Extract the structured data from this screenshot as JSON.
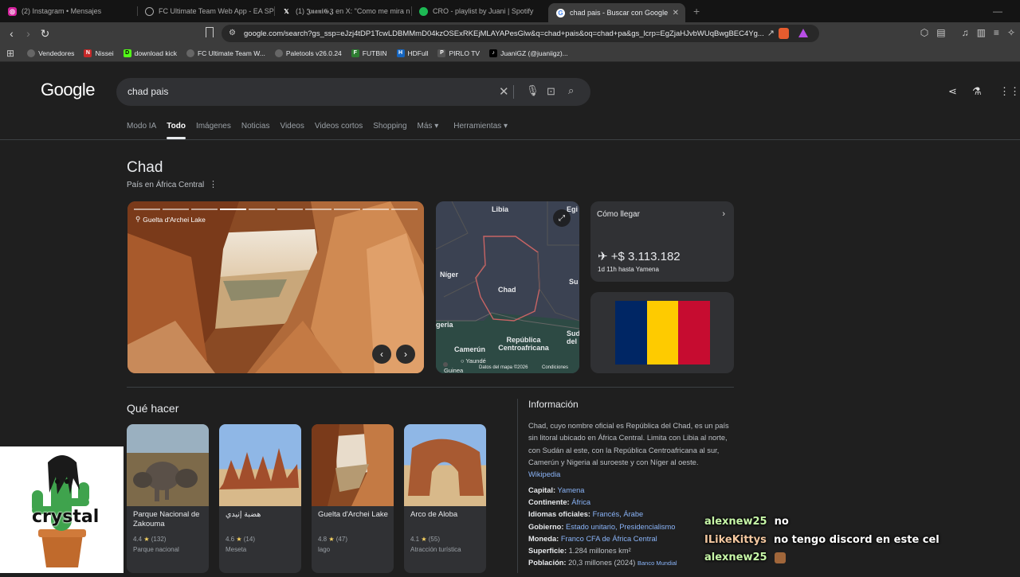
{
  "tabs": [
    {
      "label": "(2) Instagram • Mensajes",
      "icon": "instagram-icon",
      "color": "#d6249f"
    },
    {
      "label": "FC Ultimate Team Web App - EA SPO",
      "icon": "globe-icon",
      "color": "#888888"
    },
    {
      "label": "(1) 𝕵𝖚𝖆𝖓𝖎𝕲𝖅 en X: \"Como me mira n",
      "icon": "x-icon",
      "color": "#000000"
    },
    {
      "label": "CRO - playlist by Juani | Spotify",
      "icon": "spotify-icon",
      "color": "#1db954"
    },
    {
      "label": "chad pais - Buscar con Google",
      "icon": "google-icon",
      "color": "#ffffff",
      "active": true
    }
  ],
  "url": "google.com/search?gs_ssp=eJzj4tDP1TcwLDBMMmD04kzOSExRKEjMLAYAPesGlw&q=chad+pais&oq=chad+pa&gs_lcrp=EgZjaHJvbWUqBwgBEC4Yg...",
  "bookmarks": [
    {
      "label": "Vendedores",
      "icon": "globe-icon",
      "color": "#666666"
    },
    {
      "label": "Nissei",
      "icon": "nissei-icon",
      "color": "#c62828"
    },
    {
      "label": "download kick",
      "icon": "kick-icon",
      "color": "#53fc18"
    },
    {
      "label": "FC Ultimate Team W...",
      "icon": "globe-icon",
      "color": "#666666"
    },
    {
      "label": "Paletools v26.0.24",
      "icon": "globe-icon",
      "color": "#666666"
    },
    {
      "label": "FUTBIN",
      "icon": "futbin-icon",
      "color": "#2e7d32"
    },
    {
      "label": "HDFull",
      "icon": "hdfull-icon",
      "color": "#1565c0"
    },
    {
      "label": "PIRLO TV",
      "icon": "pirlo-icon",
      "color": "#555555"
    },
    {
      "label": "JuaniGZ (@juaniigz)...",
      "icon": "tiktok-icon",
      "color": "#000000"
    }
  ],
  "google": {
    "logo": "Google",
    "query": "chad pais",
    "tabs": [
      "Modo IA",
      "Todo",
      "Imágenes",
      "Noticias",
      "Videos",
      "Videos cortos",
      "Shopping",
      "Más ▾",
      "Herramientas ▾"
    ],
    "active_tab": "Todo"
  },
  "kp": {
    "title": "Chad",
    "subtitle": "País en África Central",
    "photo_label": "Guelta d'Archei Lake",
    "map_labels": {
      "libia": "Libia",
      "egipto": "Egi",
      "niger": "Níger",
      "chad": "Chad",
      "sudan": "Su",
      "nigeria": "geria",
      "camerun": "Camerún",
      "rca": "República Centroafricana",
      "yaunde": "Yaundé",
      "guinea": "Guinea",
      "sud2": "Sud del",
      "attr": "Datos del mapa ©2026",
      "cond": "Condiciones"
    },
    "route": {
      "title": "Cómo llegar",
      "price": "+$ 3.113.182",
      "duration": "1d 11h hasta Yamena"
    },
    "flag_colors": [
      "#002664",
      "#fecb00",
      "#c60c30"
    ]
  },
  "que_hacer": {
    "heading": "Qué hacer",
    "places": [
      {
        "name": "Parque Nacional de Zakouma",
        "rating": "4.4",
        "reviews": "(132)",
        "type": "Parque nacional"
      },
      {
        "name": "هضبة إنيدي",
        "rating": "4.6",
        "reviews": "(14)",
        "type": "Meseta"
      },
      {
        "name": "Guelta d'Archei Lake",
        "rating": "4.8",
        "reviews": "(47)",
        "type": "lago"
      },
      {
        "name": "Arco de Aloba",
        "rating": "4.1",
        "reviews": "(55)",
        "type": "Atracción turística"
      }
    ]
  },
  "info": {
    "heading": "Información",
    "para": "Chad, cuyo nombre oficial es República del Chad,  es un país sin litoral ubicado en África Central. Limita con Libia al norte, con Sudán al este, con la República Centroafricana al sur, Camerún y Nigeria al suroeste y con Níger al oeste.",
    "source": "Wikipedia",
    "facts": [
      {
        "k": "Capital:",
        "v": "Yamena",
        "link": true
      },
      {
        "k": "Continente:",
        "v": "África",
        "link": true
      },
      {
        "k": "Idiomas oficiales:",
        "v": "Francés, Árabe",
        "link": true
      },
      {
        "k": "Gobierno:",
        "v": "Estado unitario, Presidencialismo",
        "link": true
      },
      {
        "k": "Moneda:",
        "v": "Franco CFA de África Central",
        "link": true
      },
      {
        "k": "Superficie:",
        "v": "1.284 millones km²",
        "link": false
      },
      {
        "k": "Población:",
        "v": "20,3 millones (2024)",
        "link": false,
        "extra": "Banco Mundial"
      }
    ]
  },
  "overlay": {
    "label": "crystal"
  },
  "chat": [
    {
      "user": "alexnew25",
      "msg": "no"
    },
    {
      "user": "ILikeKittys",
      "msg": "no tengo discord en este cel"
    },
    {
      "user": "alexnew25",
      "msg": ""
    }
  ]
}
